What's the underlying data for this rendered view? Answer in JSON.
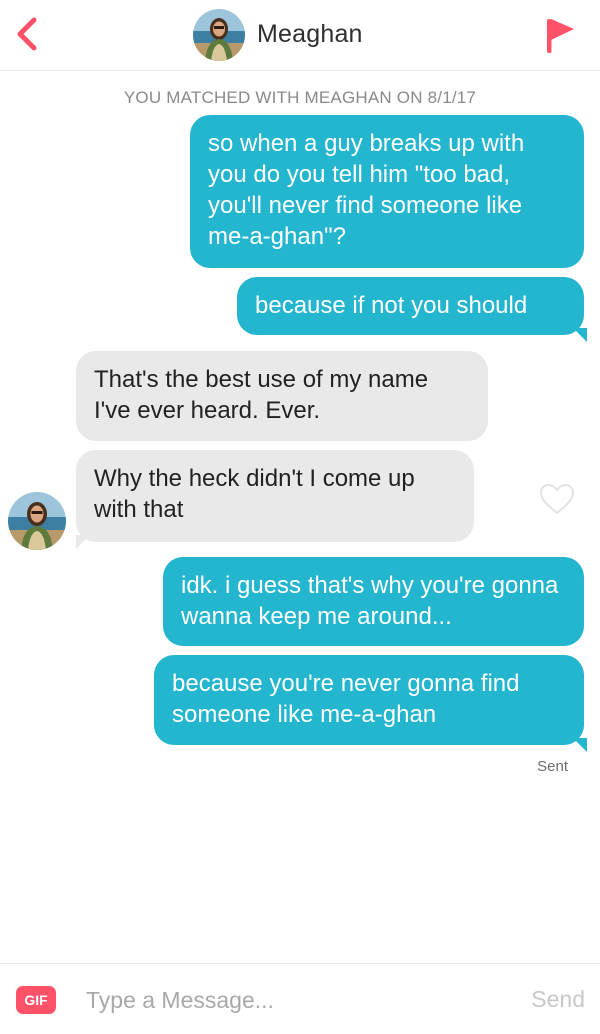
{
  "header": {
    "title": "Meaghan",
    "back_icon": "chevron-left-icon",
    "flag_icon": "flag-icon",
    "accent_color": "#fd5268"
  },
  "conversation": {
    "match_notice": "YOU MATCHED WITH MEAGHAN ON 8/1/17",
    "messages": [
      {
        "direction": "outgoing",
        "text": "so when a guy breaks up with you do you tell him \"too bad, you'll never find someone like me-a-ghan\"?"
      },
      {
        "direction": "outgoing",
        "text": "because if not you should"
      },
      {
        "direction": "incoming",
        "text": "That's the best use of my name I've ever heard. Ever."
      },
      {
        "direction": "incoming",
        "text": "Why the heck didn't I come up with that"
      },
      {
        "direction": "outgoing",
        "text": "idk. i guess that's why you're gonna wanna keep me around..."
      },
      {
        "direction": "outgoing",
        "text": "because you're never gonna find someone like me-a-ghan"
      }
    ],
    "status": "Sent",
    "like_icon": "heart-outline-icon",
    "colors": {
      "outgoing_bubble": "#24b5cf",
      "incoming_bubble": "#e9e9ea"
    }
  },
  "composer": {
    "gif_label": "GIF",
    "placeholder": "Type a Message...",
    "send_label": "Send"
  }
}
